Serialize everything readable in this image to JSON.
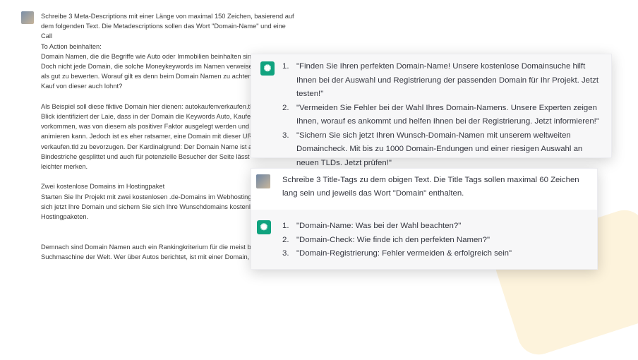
{
  "background_chat": {
    "avatar": "user-avatar",
    "text": "Schreibe 3 Meta-Descriptions mit einer Länge von maximal 150 Zeichen, basierend auf\ndem folgenden Text. Die Metadescriptions sollen das Wort \"Domain-Name\" und eine Call\nTo Action beinhalten:\nDomain Namen, die die Begriffe wie Auto oder Immobilien beinhalten sind sehr beliebt.\nDoch nicht jede Domain, die solche Moneykeywords im Namen verweise\nals gut zu bewerten. Worauf gilt es denn beim Domain Namen zu achten,\nKauf von dieser auch lohnt?\n\nAls Beispiel soll diese fiktive Domain hier dienen: autokaufenverkaufen.tl\nBlick identifiziert der Laie, dass in der Domain die Keywords Auto, Kaufen\nvorkommen, was von diesem als positiver Faktor ausgelegt werden und z\nanimieren kann. Jedoch ist es eher ratsamer, eine Domain mit dieser URL\nverkaufen.tld zu bevorzugen. Der Kardinalgrund: Der Domain Name ist an\nBindestriche gesplittet und auch für potenzielle Besucher der Seite lässt\nleichter merken.\n\nZwei kostenlose Domains im Hostingpaket\nStarten Sie Ihr Projekt mit zwei kostenlosen .de-Domains im Webhosting\nsich jetzt Ihre Domain und sichern Sie sich Ihre Wunschdomains kostenlo\nHostingpaketen.\n\n\nDemnach sind Domain Namen auch ein Rankingkriterium für die meist be\nSuchmaschine der Welt. Wer über Autos berichtet, ist mit einer Domain,"
  },
  "card1": {
    "icon": "chatgpt-icon",
    "answers": [
      {
        "num": "1.",
        "text": "\"Finden Sie Ihren perfekten Domain-Name! Unsere kostenlose Domainsuche hilft Ihnen bei der Auswahl und Registrierung der passenden Domain für Ihr Projekt. Jetzt testen!\""
      },
      {
        "num": "2.",
        "text": "\"Vermeiden Sie Fehler bei der Wahl Ihres Domain-Namens. Unsere Experten zeigen Ihnen, worauf es ankommt und helfen Ihnen bei der Registrierung. Jetzt informieren!\""
      },
      {
        "num": "3.",
        "text": "\"Sichern Sie sich jetzt Ihren Wunsch-Domain-Namen mit unserem weltweiten Domaincheck. Mit bis zu 1000 Domain-Endungen und einer riesigen Auswahl an neuen TLDs. Jetzt prüfen!\""
      }
    ]
  },
  "card2": {
    "prompt": "Schreibe 3 Title-Tags zu dem obigen Text. Die Title Tags sollen maximal 60 Zeichen lang sein und jeweils das Wort \"Domain\" enthalten.",
    "answers": [
      {
        "num": "1.",
        "text": "\"Domain-Name: Was bei der Wahl beachten?\""
      },
      {
        "num": "2.",
        "text": "\"Domain-Check: Wie finde ich den perfekten Namen?\""
      },
      {
        "num": "3.",
        "text": "\"Domain-Registrierung: Fehler vermeiden & erfolgreich sein\""
      }
    ]
  }
}
